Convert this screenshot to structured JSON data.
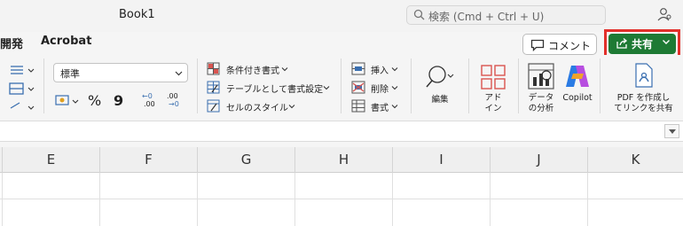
{
  "title": "Book1",
  "search": {
    "placeholder": "検索 (Cmd + Ctrl + U)"
  },
  "tabs": {
    "dev": "開発",
    "acrobat": "Acrobat"
  },
  "actions": {
    "comment": "コメント",
    "share": "共有"
  },
  "ribbon": {
    "number_format": "標準",
    "percent": "%",
    "comma": "9",
    "inc_decimal_top": "←0",
    "inc_decimal_bottom": ".00",
    "dec_decimal_top": ".00",
    "dec_decimal_bottom": "→0",
    "styles": {
      "conditional": "条件付き書式",
      "table": "テーブルとして書式設定",
      "cell": "セルのスタイル"
    },
    "cells": {
      "insert": "挿入",
      "delete": "削除",
      "format": "書式"
    },
    "editing": "編集",
    "addins_1": "アド",
    "addins_2": "イン",
    "analysis_1": "データ",
    "analysis_2": "の分析",
    "copilot": "Copilot",
    "pdf_1": "PDF を作成し",
    "pdf_2": "てリンクを共有"
  },
  "columns": [
    "E",
    "F",
    "G",
    "H",
    "I",
    "J",
    "K"
  ],
  "colors": {
    "share_green": "#1e7a34",
    "highlight_red": "#e2302b"
  }
}
